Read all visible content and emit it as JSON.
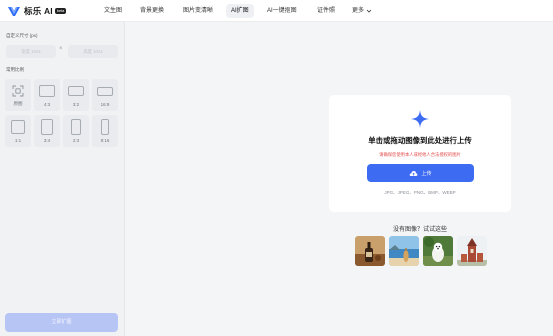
{
  "brand": {
    "name": "标乐 AI",
    "badge": "beta",
    "accent": "#3d6cf2"
  },
  "nav": {
    "items": [
      {
        "label": "文生图",
        "active": false
      },
      {
        "label": "背景更换",
        "active": false
      },
      {
        "label": "图片变清晰",
        "active": false
      },
      {
        "label": "AI扩图",
        "active": true
      },
      {
        "label": "AI一键抠图",
        "active": false
      },
      {
        "label": "证件照",
        "active": false
      }
    ],
    "more_label": "更多"
  },
  "sidebar": {
    "custom_size_label": "自定义尺寸 (px)",
    "width_placeholder": "宽度 1024",
    "height_placeholder": "高度 1024",
    "separator": "×",
    "ratio_label": "常用比例",
    "ratios": [
      {
        "label": "原图",
        "icon": "focus-frame-icon"
      },
      {
        "label": "4:3",
        "icon": "ratio-4-3-icon"
      },
      {
        "label": "3:2",
        "icon": "ratio-3-2-icon"
      },
      {
        "label": "16:9",
        "icon": "ratio-16-9-icon"
      },
      {
        "label": "1:1",
        "icon": "ratio-1-1-icon"
      },
      {
        "label": "3:4",
        "icon": "ratio-3-4-icon"
      },
      {
        "label": "2:3",
        "icon": "ratio-2-3-icon"
      },
      {
        "label": "9:16",
        "icon": "ratio-9-16-icon"
      }
    ],
    "submit_label": "立即扩图"
  },
  "upload": {
    "title": "单击或拖动图像到此处进行上传",
    "warning": "请确保您使用本人或经他人合法授权的图片",
    "button_label": "上传",
    "formats": "JPG、JPEG、PNG、BMP、WEBP",
    "warning_color": "#e24a4a"
  },
  "samples": {
    "title": "没有图像？试试这些",
    "items": [
      {
        "icon": "sample-bottle-image"
      },
      {
        "icon": "sample-beach-image"
      },
      {
        "icon": "sample-dog-image"
      },
      {
        "icon": "sample-tower-image"
      }
    ]
  }
}
